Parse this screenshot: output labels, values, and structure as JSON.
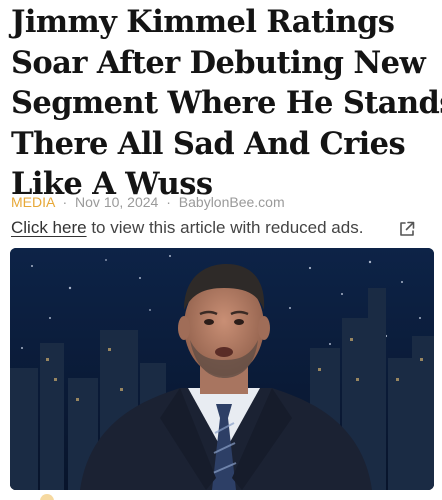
{
  "article": {
    "headline_lines": [
      "Jimmy Kimmel Ratings",
      "Soar After Debuting New",
      "Segment Where He Stands",
      "There All Sad And Cries",
      "Like A Wuss"
    ],
    "category": "MEDIA",
    "separator": "·",
    "date": "Nov 10, 2024",
    "source": "BabylonBee.com"
  },
  "reduced_ads": {
    "link_text": "Click here",
    "rest_text": " to view this article with reduced ads."
  },
  "icons": {
    "external_link": "external-link-icon"
  },
  "colors": {
    "category": "#e7a838",
    "meta_text": "#9a9a9a",
    "headline": "#141414",
    "hero_sky": "#0b1a33"
  }
}
